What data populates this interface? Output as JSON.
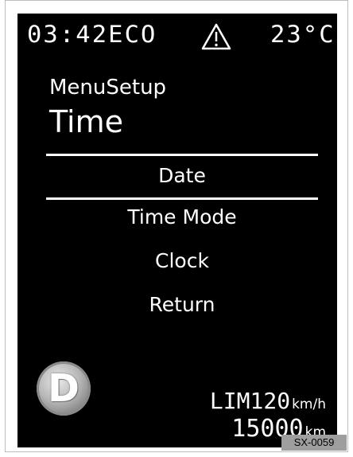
{
  "status_bar": {
    "time": "03:42",
    "mode": "ECO",
    "temperature": "23°C",
    "warning_icon": "warning-triangle-icon"
  },
  "menu": {
    "group_title": "MenuSetup",
    "title": "Time",
    "items": [
      {
        "label": "Date",
        "selected": true
      },
      {
        "label": "Time Mode",
        "selected": false
      },
      {
        "label": "Clock",
        "selected": false
      },
      {
        "label": "Return",
        "selected": false
      }
    ]
  },
  "footer": {
    "gear": "D",
    "speed_limit_label": "LIM",
    "speed_limit_value": "120",
    "speed_limit_unit": "km/h",
    "odometer_value": "15000",
    "odometer_unit": "km"
  },
  "caption": "SX-0059",
  "colors": {
    "screen_bg": "#000000",
    "text": "#ffffff",
    "caption_bg": "#9e9e9e"
  }
}
